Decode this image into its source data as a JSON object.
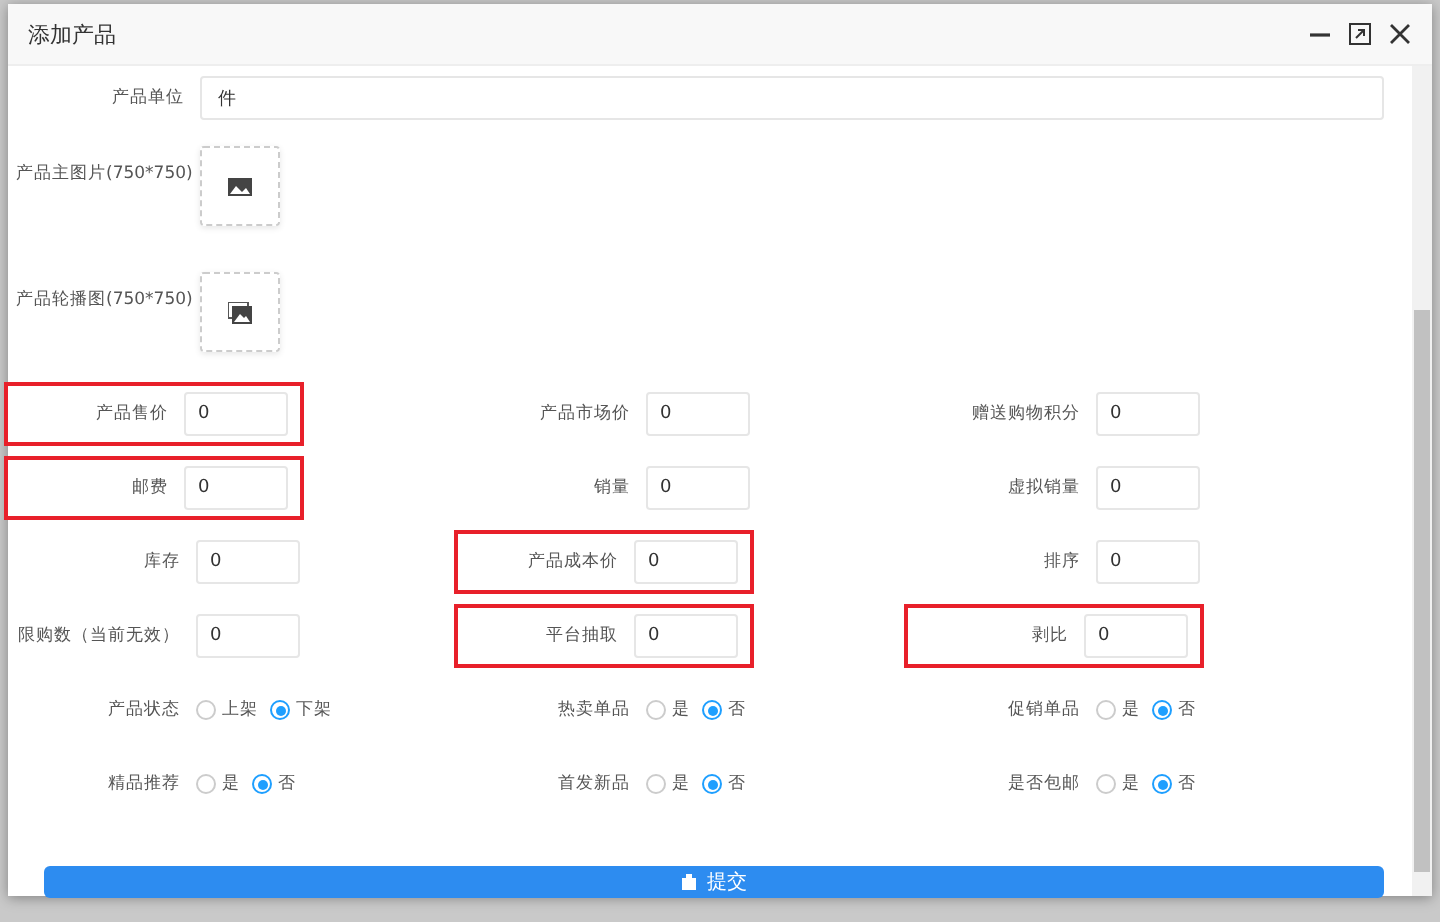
{
  "window": {
    "title": "添加产品"
  },
  "unit": {
    "label": "产品单位",
    "value": "件"
  },
  "images": [
    {
      "label": "产品主图片(750*750)",
      "kind": "single"
    },
    {
      "label": "产品轮播图(750*750)",
      "kind": "multi"
    }
  ],
  "fields": [
    {
      "kind": "input",
      "label": "产品售价",
      "value": "0",
      "highlighted": true
    },
    {
      "kind": "input",
      "label": "产品市场价",
      "value": "0",
      "highlighted": false
    },
    {
      "kind": "input",
      "label": "赠送购物积分",
      "value": "0",
      "highlighted": false
    },
    {
      "kind": "input",
      "label": "邮费",
      "value": "0",
      "highlighted": true
    },
    {
      "kind": "input",
      "label": "销量",
      "value": "0",
      "highlighted": false
    },
    {
      "kind": "input",
      "label": "虚拟销量",
      "value": "0",
      "highlighted": false
    },
    {
      "kind": "input",
      "label": "库存",
      "value": "0",
      "highlighted": false
    },
    {
      "kind": "input",
      "label": "产品成本价",
      "value": "0",
      "highlighted": true
    },
    {
      "kind": "input",
      "label": "排序",
      "value": "0",
      "highlighted": false
    },
    {
      "kind": "input",
      "label": "限购数（当前无效）",
      "value": "0",
      "highlighted": false
    },
    {
      "kind": "input",
      "label": "平台抽取",
      "value": "0",
      "highlighted": true
    },
    {
      "kind": "input",
      "label": "剥比",
      "value": "0",
      "highlighted": true
    },
    {
      "kind": "radio",
      "label": "产品状态",
      "highlighted": false,
      "options": [
        {
          "label": "上架",
          "selected": false
        },
        {
          "label": "下架",
          "selected": true
        }
      ]
    },
    {
      "kind": "radio",
      "label": "热卖单品",
      "highlighted": false,
      "options": [
        {
          "label": "是",
          "selected": false
        },
        {
          "label": "否",
          "selected": true
        }
      ]
    },
    {
      "kind": "radio",
      "label": "促销单品",
      "highlighted": false,
      "options": [
        {
          "label": "是",
          "selected": false
        },
        {
          "label": "否",
          "selected": true
        }
      ]
    },
    {
      "kind": "radio",
      "label": "精品推荐",
      "highlighted": false,
      "options": [
        {
          "label": "是",
          "selected": false
        },
        {
          "label": "否",
          "selected": true
        }
      ]
    },
    {
      "kind": "radio",
      "label": "首发新品",
      "highlighted": false,
      "options": [
        {
          "label": "是",
          "selected": false
        },
        {
          "label": "否",
          "selected": true
        }
      ]
    },
    {
      "kind": "radio",
      "label": "是否包邮",
      "highlighted": false,
      "options": [
        {
          "label": "是",
          "selected": false
        },
        {
          "label": "否",
          "selected": true
        }
      ]
    }
  ],
  "submit": {
    "label": "提交"
  }
}
